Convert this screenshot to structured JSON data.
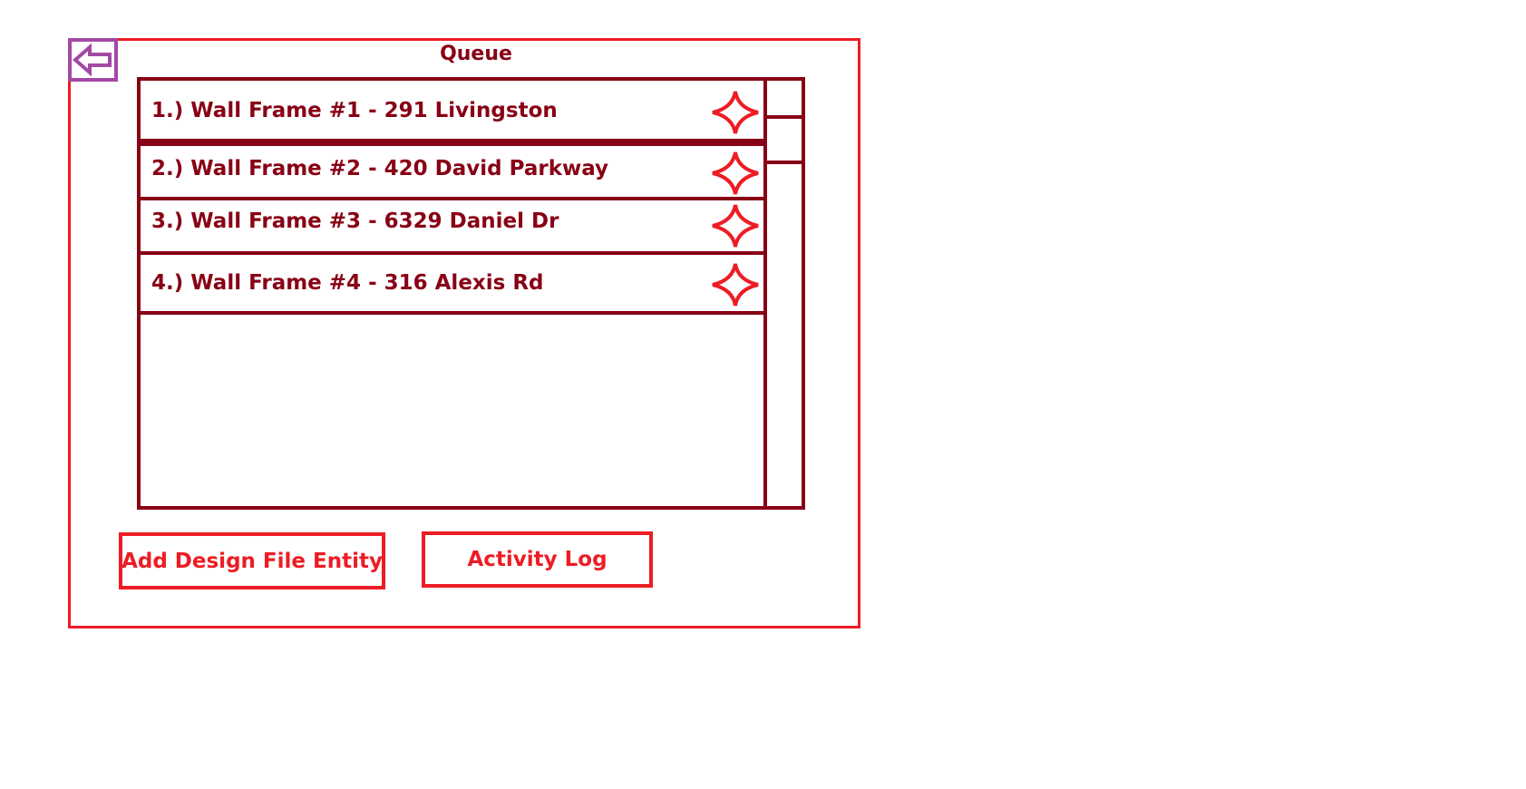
{
  "window": {
    "title": "Queue"
  },
  "toolbar": {
    "back_icon": "back-arrow-icon"
  },
  "queue": {
    "items": [
      {
        "label": "1.) Wall Frame #1 - 291 Livingston",
        "icon": "star-icon"
      },
      {
        "label": "2.) Wall Frame #2 - 420 David Parkway",
        "icon": "star-icon"
      },
      {
        "label": "3.) Wall Frame #3 - 6329 Daniel Dr",
        "icon": "star-icon"
      },
      {
        "label": "4.) Wall Frame #4 - 316 Alexis Rd",
        "icon": "star-icon"
      }
    ]
  },
  "actions": {
    "add_label": "Add Design File Entity",
    "log_label": "Activity Log"
  },
  "colors": {
    "frame": "#ed1c24",
    "list": "#880015",
    "back_button": "#a349a4",
    "star": "#ed1c24"
  }
}
